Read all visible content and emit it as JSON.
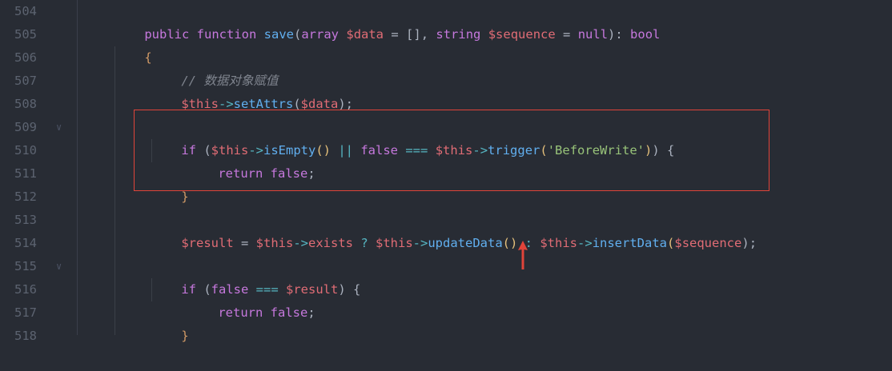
{
  "lines": [
    {
      "num": "504",
      "fold": false
    },
    {
      "num": "505",
      "fold": false
    },
    {
      "num": "506",
      "fold": false
    },
    {
      "num": "507",
      "fold": false
    },
    {
      "num": "508",
      "fold": false
    },
    {
      "num": "509",
      "fold": true
    },
    {
      "num": "510",
      "fold": false
    },
    {
      "num": "511",
      "fold": false
    },
    {
      "num": "512",
      "fold": false
    },
    {
      "num": "513",
      "fold": false
    },
    {
      "num": "514",
      "fold": false
    },
    {
      "num": "515",
      "fold": true
    },
    {
      "num": "516",
      "fold": false
    },
    {
      "num": "517",
      "fold": false
    },
    {
      "num": "518",
      "fold": false
    }
  ],
  "code": {
    "l504": {
      "kw_public": "public",
      "kw_function": "function",
      "fn_save": "save",
      "p_open": "(",
      "t_array": "array",
      "v_data": "$data",
      "eq": " = ",
      "empty_arr": "[]",
      "comma": ", ",
      "t_string": "string",
      "v_sequence": "$sequence",
      "eq2": " = ",
      "kw_null": "null",
      "p_close": "): ",
      "t_bool": "bool"
    },
    "l505": {
      "brace": "{"
    },
    "l506": {
      "comment": "// 数据对象赋值"
    },
    "l507": {
      "v_this": "$this",
      "arrow": "->",
      "fn": "setAttrs",
      "open": "(",
      "v_data": "$data",
      "close": ");"
    },
    "l509": {
      "kw_if": "if",
      "open": " (",
      "v_this": "$this",
      "arrow": "->",
      "fn_isEmpty": "isEmpty",
      "call": "()",
      "or": " || ",
      "kw_false": "false",
      "eqeq": " === ",
      "v_this2": "$this",
      "arrow2": "->",
      "fn_trigger": "trigger",
      "p1": "(",
      "str": "'BeforeWrite'",
      "p2": ")",
      "p3": ") {"
    },
    "l510": {
      "kw_return": "return",
      "kw_false": "false",
      "semi": ";"
    },
    "l511": {
      "brace": "}"
    },
    "l513": {
      "v_result": "$result",
      "eq": " = ",
      "v_this": "$this",
      "arrow": "->",
      "prop": "exists",
      "q": " ? ",
      "v_this2": "$this",
      "arrow2": "->",
      "fn_update": "updateData",
      "call": "()",
      "colon": " : ",
      "v_this3": "$this",
      "arrow3": "->",
      "fn_insert": "insertData",
      "p1": "(",
      "v_sequence": "$sequence",
      "p2": ");"
    },
    "l515": {
      "kw_if": "if",
      "open": " (",
      "kw_false": "false",
      "eqeq": " === ",
      "v_result": "$result",
      "close": ") {"
    },
    "l516": {
      "kw_return": "return",
      "kw_false": "false",
      "semi": ";"
    },
    "l517": {
      "brace": "}"
    }
  },
  "colors": {
    "background": "#282c34",
    "highlight_box": "#e0443a",
    "arrow": "#e0443a"
  }
}
